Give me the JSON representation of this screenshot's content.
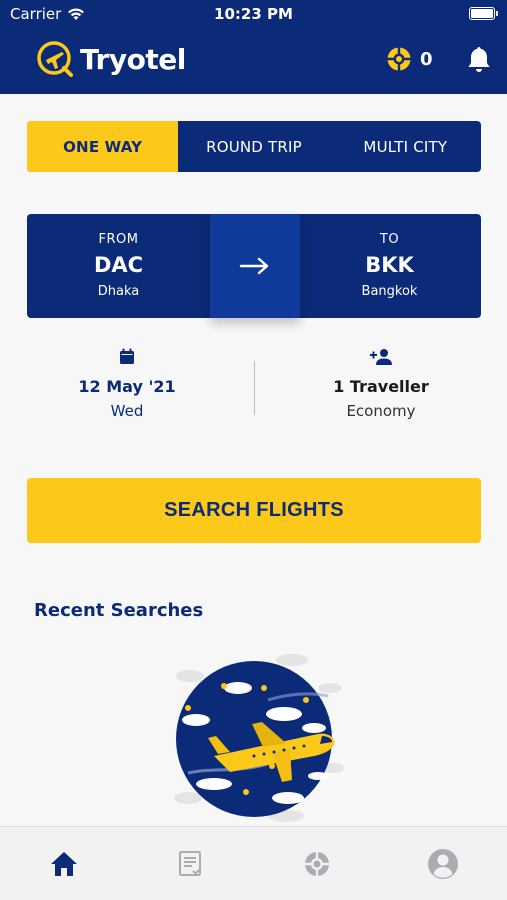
{
  "status_bar": {
    "carrier": "Carrier",
    "time": "10:23 PM"
  },
  "header": {
    "brand": "Tryotel",
    "coins_count": "0",
    "icons": [
      "plane-logo-icon",
      "lifebuoy-icon",
      "bell-icon"
    ]
  },
  "trip_tabs": [
    {
      "label": "ONE WAY",
      "active": true
    },
    {
      "label": "ROUND TRIP",
      "active": false
    },
    {
      "label": "MULTI CITY",
      "active": false
    }
  ],
  "route": {
    "from": {
      "label": "FROM",
      "code": "DAC",
      "city": "Dhaka"
    },
    "to": {
      "label": "TO",
      "code": "BKK",
      "city": "Bangkok"
    },
    "swap_icon": "arrow-right-icon"
  },
  "date": {
    "main": "12 May '21",
    "sub": "Wed",
    "icon": "calendar-icon"
  },
  "traveller": {
    "main": "1 Traveller",
    "sub": "Economy",
    "icon": "add-person-icon"
  },
  "search_button": "SEARCH FLIGHTS",
  "recent": {
    "title": "Recent Searches"
  },
  "bottom_nav": [
    {
      "name": "home",
      "icon": "home-icon",
      "active": true
    },
    {
      "name": "bookings",
      "icon": "list-check-icon",
      "active": false
    },
    {
      "name": "support",
      "icon": "lifebuoy-icon",
      "active": false
    },
    {
      "name": "profile",
      "icon": "user-circle-icon",
      "active": false
    }
  ],
  "colors": {
    "navy": "#0b2a77",
    "yellow": "#fcc819",
    "background": "#f7f7f7",
    "inactive_icon": "#a9acb3"
  }
}
